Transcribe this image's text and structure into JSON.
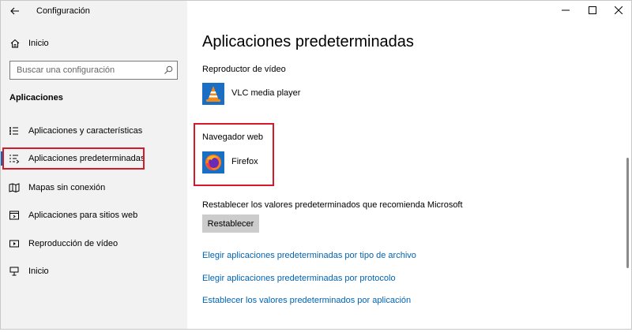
{
  "window": {
    "title": "Configuración",
    "controls": [
      "minimize",
      "maximize",
      "close"
    ]
  },
  "sidebar": {
    "home_label": "Inicio",
    "search_placeholder": "Buscar una configuración",
    "section_title": "Aplicaciones",
    "items": [
      {
        "label": "Aplicaciones y características",
        "icon": "list-icon"
      },
      {
        "label": "Aplicaciones predeterminadas",
        "icon": "default-apps-icon",
        "active": true
      },
      {
        "label": "Mapas sin conexión",
        "icon": "map-icon"
      },
      {
        "label": "Aplicaciones para sitios web",
        "icon": "web-app-icon"
      },
      {
        "label": "Reproducción de vídeo",
        "icon": "video-icon"
      },
      {
        "label": "Inicio",
        "icon": "startup-icon"
      }
    ]
  },
  "main": {
    "title": "Aplicaciones predeterminadas",
    "video_label": "Reproductor de vídeo",
    "video_app": "VLC media player",
    "browser_label": "Navegador web",
    "browser_app": "Firefox",
    "reset_desc": "Restablecer los valores predeterminados que recomienda Microsoft",
    "reset_button": "Restablecer",
    "links": [
      "Elegir aplicaciones predeterminadas por tipo de archivo",
      "Elegir aplicaciones predeterminadas por protocolo",
      "Establecer los valores predeterminados por aplicación"
    ]
  },
  "colors": {
    "accent": "#0067c0",
    "link": "#0063b1",
    "highlight": "#d8192c",
    "sidebar_bg": "#f2f2f2"
  }
}
